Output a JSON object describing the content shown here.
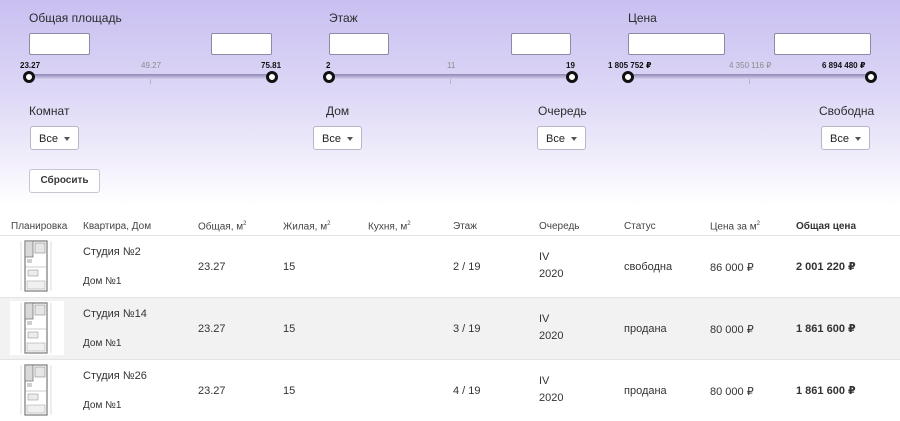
{
  "filters": {
    "area": {
      "label": "Общая площадь",
      "min": "23.27",
      "mid": "49.27",
      "max": "75.81"
    },
    "floor": {
      "label": "Этаж",
      "min": "2",
      "mid": "11",
      "max": "19"
    },
    "price": {
      "label": "Цена",
      "min": "1 805 752 ₽",
      "mid": "4 350 116 ₽",
      "max": "6 894 480 ₽"
    },
    "rooms": {
      "label": "Комнат",
      "value": "Все"
    },
    "house": {
      "label": "Дом",
      "value": "Все"
    },
    "queue": {
      "label": "Очередь",
      "value": "Все"
    },
    "free": {
      "label": "Свободна",
      "value": "Все"
    },
    "reset_label": "Сбросить"
  },
  "table": {
    "headers": {
      "plan": "Планировка",
      "apartment": "Квартира, Дом",
      "total": "Общая, м",
      "living": "Жилая, м",
      "kitchen": "Кухня, м",
      "floor": "Этаж",
      "queue": "Очередь",
      "status": "Статус",
      "price_m2": "Цена за м",
      "price_total": "Общая цена",
      "sq": "2"
    },
    "rows": [
      {
        "name": "Студия №2",
        "house": "Дом №1",
        "total": "23.27",
        "living": "15",
        "floor": "2 / 19",
        "queue": "IV",
        "year": "2020",
        "status": "свободна",
        "price_m2": "86 000 ₽",
        "price_total": "2 001 220 ₽"
      },
      {
        "name": "Студия №14",
        "house": "Дом №1",
        "total": "23.27",
        "living": "15",
        "floor": "3 / 19",
        "queue": "IV",
        "year": "2020",
        "status": "продана",
        "price_m2": "80 000 ₽",
        "price_total": "1 861 600 ₽"
      },
      {
        "name": "Студия №26",
        "house": "Дом №1",
        "total": "23.27",
        "living": "15",
        "floor": "4 / 19",
        "queue": "IV",
        "year": "2020",
        "status": "продана",
        "price_m2": "80 000 ₽",
        "price_total": "1 861 600 ₽"
      }
    ]
  },
  "colors": {
    "accent": "#c9c0f1",
    "status_free": "#2e5f9c",
    "knob_border": "#111111"
  }
}
